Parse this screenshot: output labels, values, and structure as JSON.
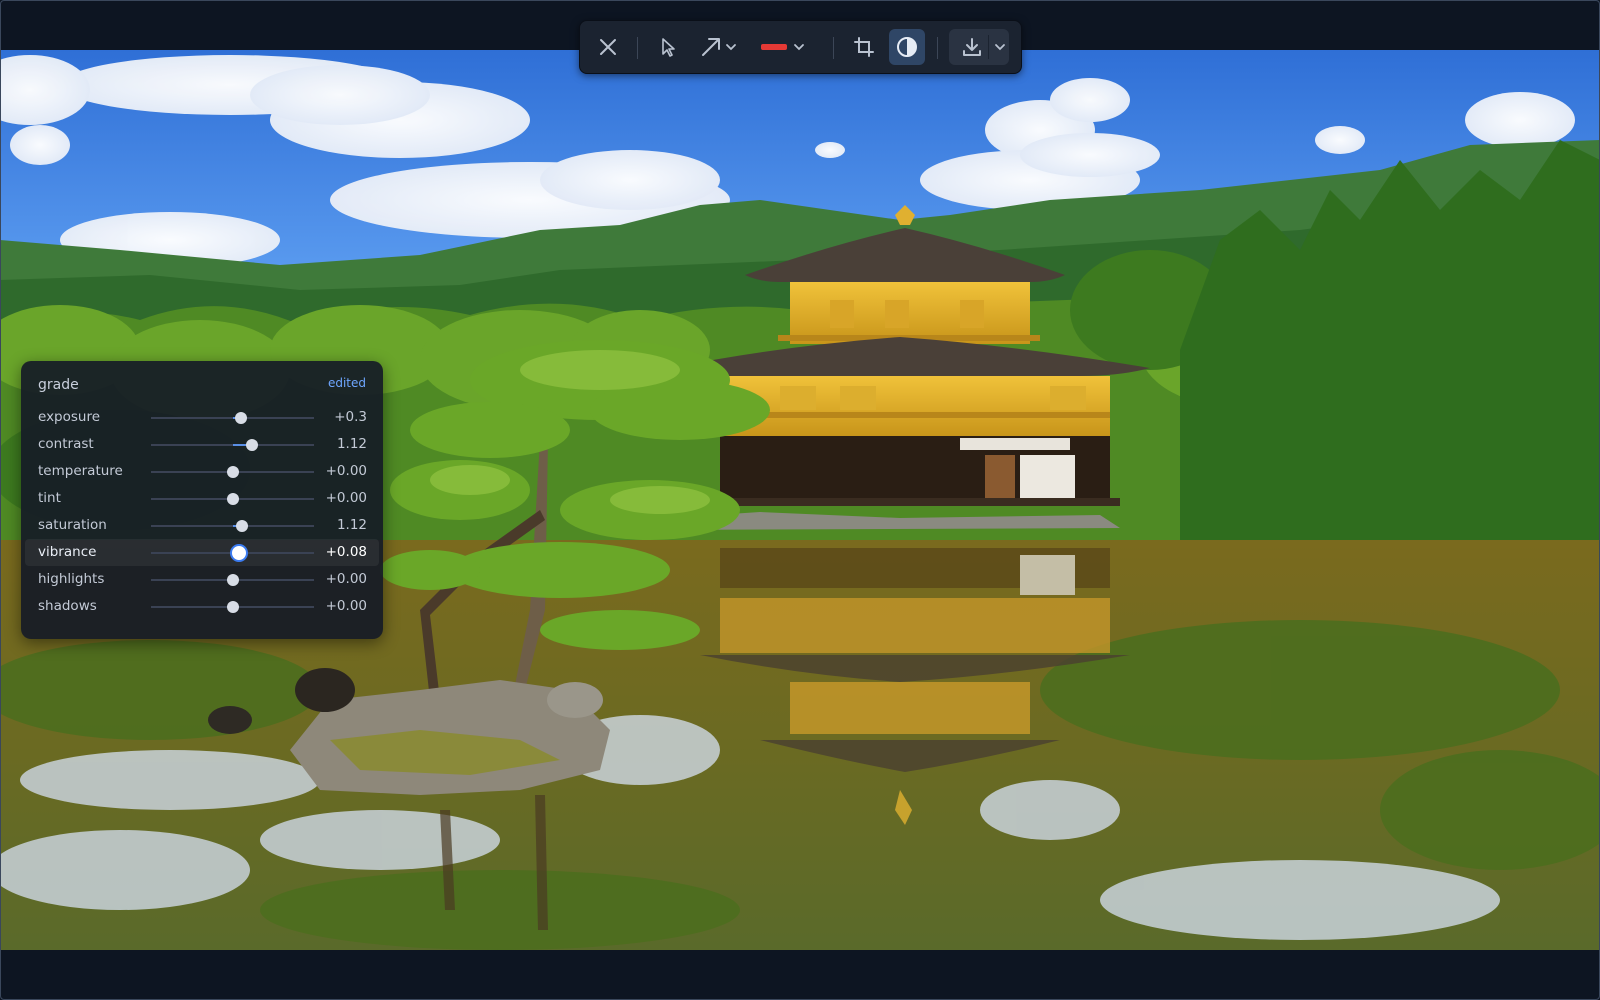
{
  "toolbar": {
    "buttons": [
      {
        "name": "close-button",
        "icon": "close-icon"
      },
      {
        "name": "select-tool-button",
        "icon": "cursor-icon"
      },
      {
        "name": "arrow-tool-button",
        "icon": "arrow-icon"
      },
      {
        "name": "arrow-options-dropdown",
        "icon": "chevron-down-icon"
      },
      {
        "name": "color-picker-button",
        "icon": "color-swatch",
        "color": "#e53935"
      },
      {
        "name": "crop-tool-button",
        "icon": "crop-icon"
      },
      {
        "name": "grade-tool-button",
        "icon": "contrast-icon",
        "active": true
      },
      {
        "name": "export-button",
        "icon": "download-icon"
      },
      {
        "name": "export-options-dropdown",
        "icon": "chevron-down-icon"
      }
    ],
    "accent_color": "#3b7bf0",
    "stroke_color": "#e53935"
  },
  "grade": {
    "title": "grade",
    "status": "edited",
    "selected": "vibrance",
    "controls": [
      {
        "key": "exposure",
        "label": "exposure",
        "value": "+0.3",
        "level": 0.55
      },
      {
        "key": "contrast",
        "label": "contrast",
        "value": "1.12",
        "level": 0.62
      },
      {
        "key": "temperature",
        "label": "temperature",
        "value": "+0.00",
        "level": 0.5
      },
      {
        "key": "tint",
        "label": "tint",
        "value": "+0.00",
        "level": 0.5
      },
      {
        "key": "saturation",
        "label": "saturation",
        "value": "1.12",
        "level": 0.56
      },
      {
        "key": "vibrance",
        "label": "vibrance",
        "value": "+0.08",
        "level": 0.54
      },
      {
        "key": "highlights",
        "label": "highlights",
        "value": "+0.00",
        "level": 0.5
      },
      {
        "key": "shadows",
        "label": "shadows",
        "value": "+0.00",
        "level": 0.5
      }
    ]
  }
}
